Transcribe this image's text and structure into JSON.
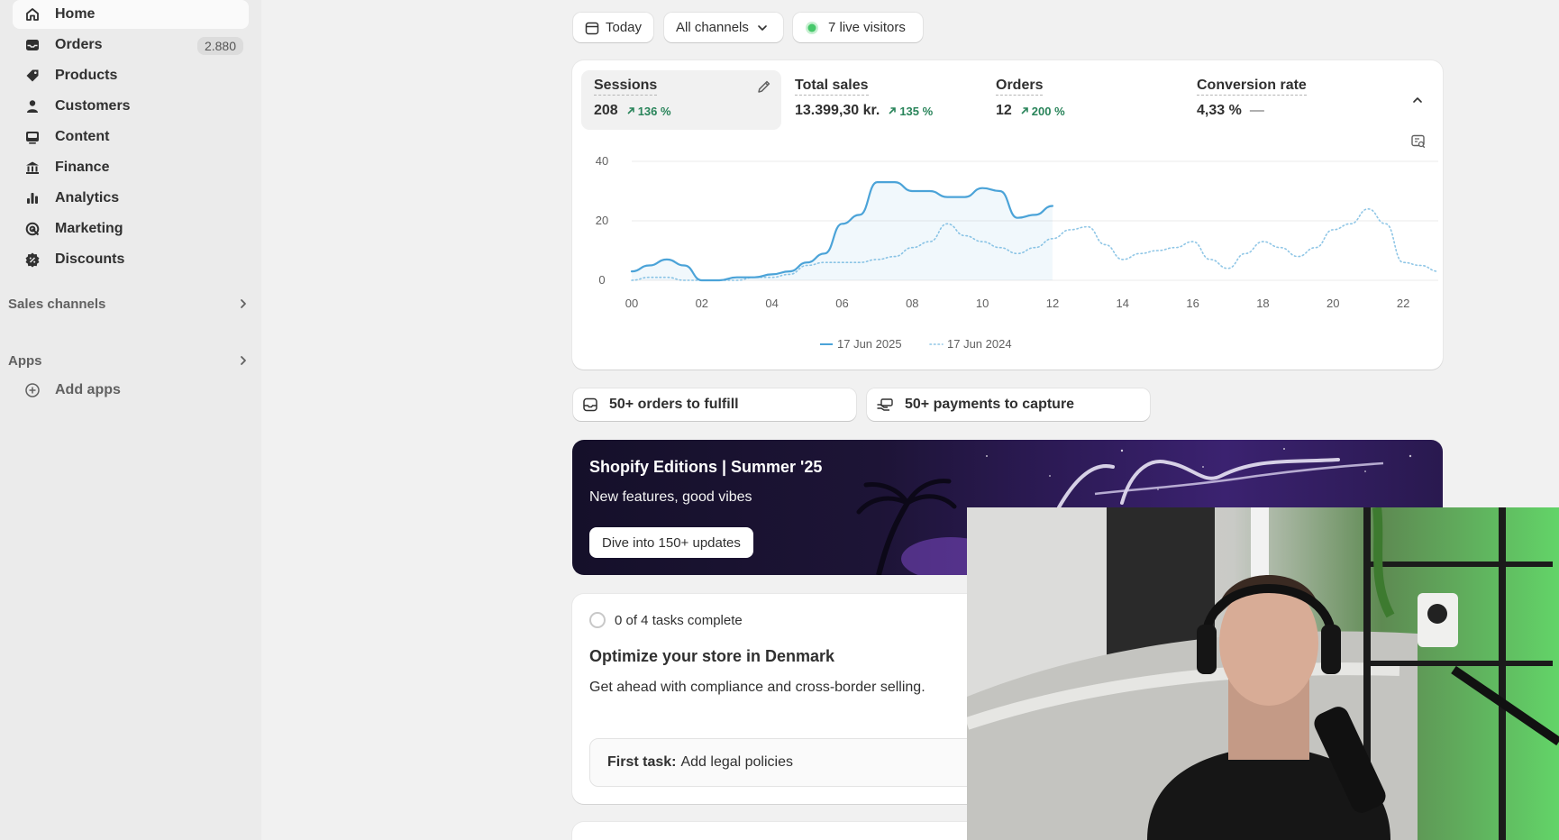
{
  "sidebar": {
    "items": [
      {
        "label": "Home",
        "icon": "home-icon"
      },
      {
        "label": "Orders",
        "icon": "inbox-icon",
        "count": "2.880"
      },
      {
        "label": "Products",
        "icon": "tag-icon"
      },
      {
        "label": "Customers",
        "icon": "person-icon"
      },
      {
        "label": "Content",
        "icon": "image-icon"
      },
      {
        "label": "Finance",
        "icon": "bank-icon"
      },
      {
        "label": "Analytics",
        "icon": "bar-chart-icon"
      },
      {
        "label": "Marketing",
        "icon": "target-icon"
      },
      {
        "label": "Discounts",
        "icon": "discount-icon"
      }
    ],
    "sales_channels": "Sales channels",
    "apps": "Apps",
    "add_apps": "Add apps"
  },
  "filters": {
    "date": "Today",
    "channels": "All channels",
    "visitors": "7 live visitors"
  },
  "metrics": [
    {
      "title": "Sessions",
      "value": "208",
      "delta": "136 %"
    },
    {
      "title": "Total sales",
      "value": "13.399,30 kr.",
      "delta": "135 %"
    },
    {
      "title": "Orders",
      "value": "12",
      "delta": "200 %"
    },
    {
      "title": "Conversion rate",
      "value": "4,33 %",
      "delta": "—"
    }
  ],
  "chart_data": {
    "type": "line",
    "x": [
      0,
      0.5,
      1,
      1.5,
      2,
      2.5,
      3,
      3.5,
      4,
      4.5,
      5,
      5.5,
      6,
      6.5,
      7,
      7.5,
      8,
      8.5,
      9,
      9.5,
      10,
      10.5,
      11,
      11.5,
      12,
      12.5,
      13,
      13.5,
      14,
      14.5,
      15,
      15.5,
      16,
      16.5,
      17,
      17.5,
      18,
      18.5,
      19,
      19.5,
      20,
      20.5,
      21,
      21.5,
      22,
      22.5,
      23
    ],
    "series": [
      {
        "name": "17 Jun 2025",
        "values": [
          3,
          5,
          7,
          5,
          0,
          0,
          1,
          1,
          2,
          3,
          6,
          9,
          19,
          22,
          33,
          33,
          30,
          30,
          28,
          28,
          31,
          30,
          21,
          22,
          25,
          null,
          null,
          null,
          null,
          null,
          null,
          null,
          null,
          null,
          null,
          null,
          null,
          null,
          null,
          null,
          null,
          null,
          null,
          null,
          null,
          null,
          null
        ]
      },
      {
        "name": "17 Jun 2024",
        "values": [
          0,
          1,
          1,
          0,
          0,
          0,
          0,
          1,
          1,
          2,
          5,
          6,
          6,
          6,
          7,
          8,
          11,
          13,
          19,
          15,
          13,
          11,
          9,
          11,
          14,
          17,
          18,
          12,
          7,
          9,
          10,
          11,
          13,
          7,
          4,
          9,
          13,
          11,
          8,
          11,
          17,
          19,
          24,
          19,
          6,
          5,
          3
        ]
      }
    ],
    "xticks": [
      "00",
      "02",
      "04",
      "06",
      "08",
      "10",
      "12",
      "14",
      "16",
      "18",
      "20",
      "22"
    ],
    "yticks": [
      "0",
      "20",
      "40"
    ],
    "ylim": [
      0,
      40
    ],
    "xlim": [
      0,
      23
    ],
    "grid": true,
    "legend": "bottom-center"
  },
  "shortcuts": {
    "orders": "50+ orders to fulfill",
    "payments": "50+ payments to capture"
  },
  "banner": {
    "title": "Shopify Editions | Summer '25",
    "subtitle": "New features, good vibes",
    "button": "Dive into 150+ updates"
  },
  "tasks": {
    "status": "0 of 4 tasks complete",
    "title": "Optimize your store in Denmark",
    "description": "Get ahead with compliance and cross-border selling.",
    "first_label": "First task:",
    "first_task": "Add legal policies"
  },
  "colors": {
    "accent": "#4ba3d8",
    "positive": "#29845a",
    "live": "#46c86a"
  }
}
